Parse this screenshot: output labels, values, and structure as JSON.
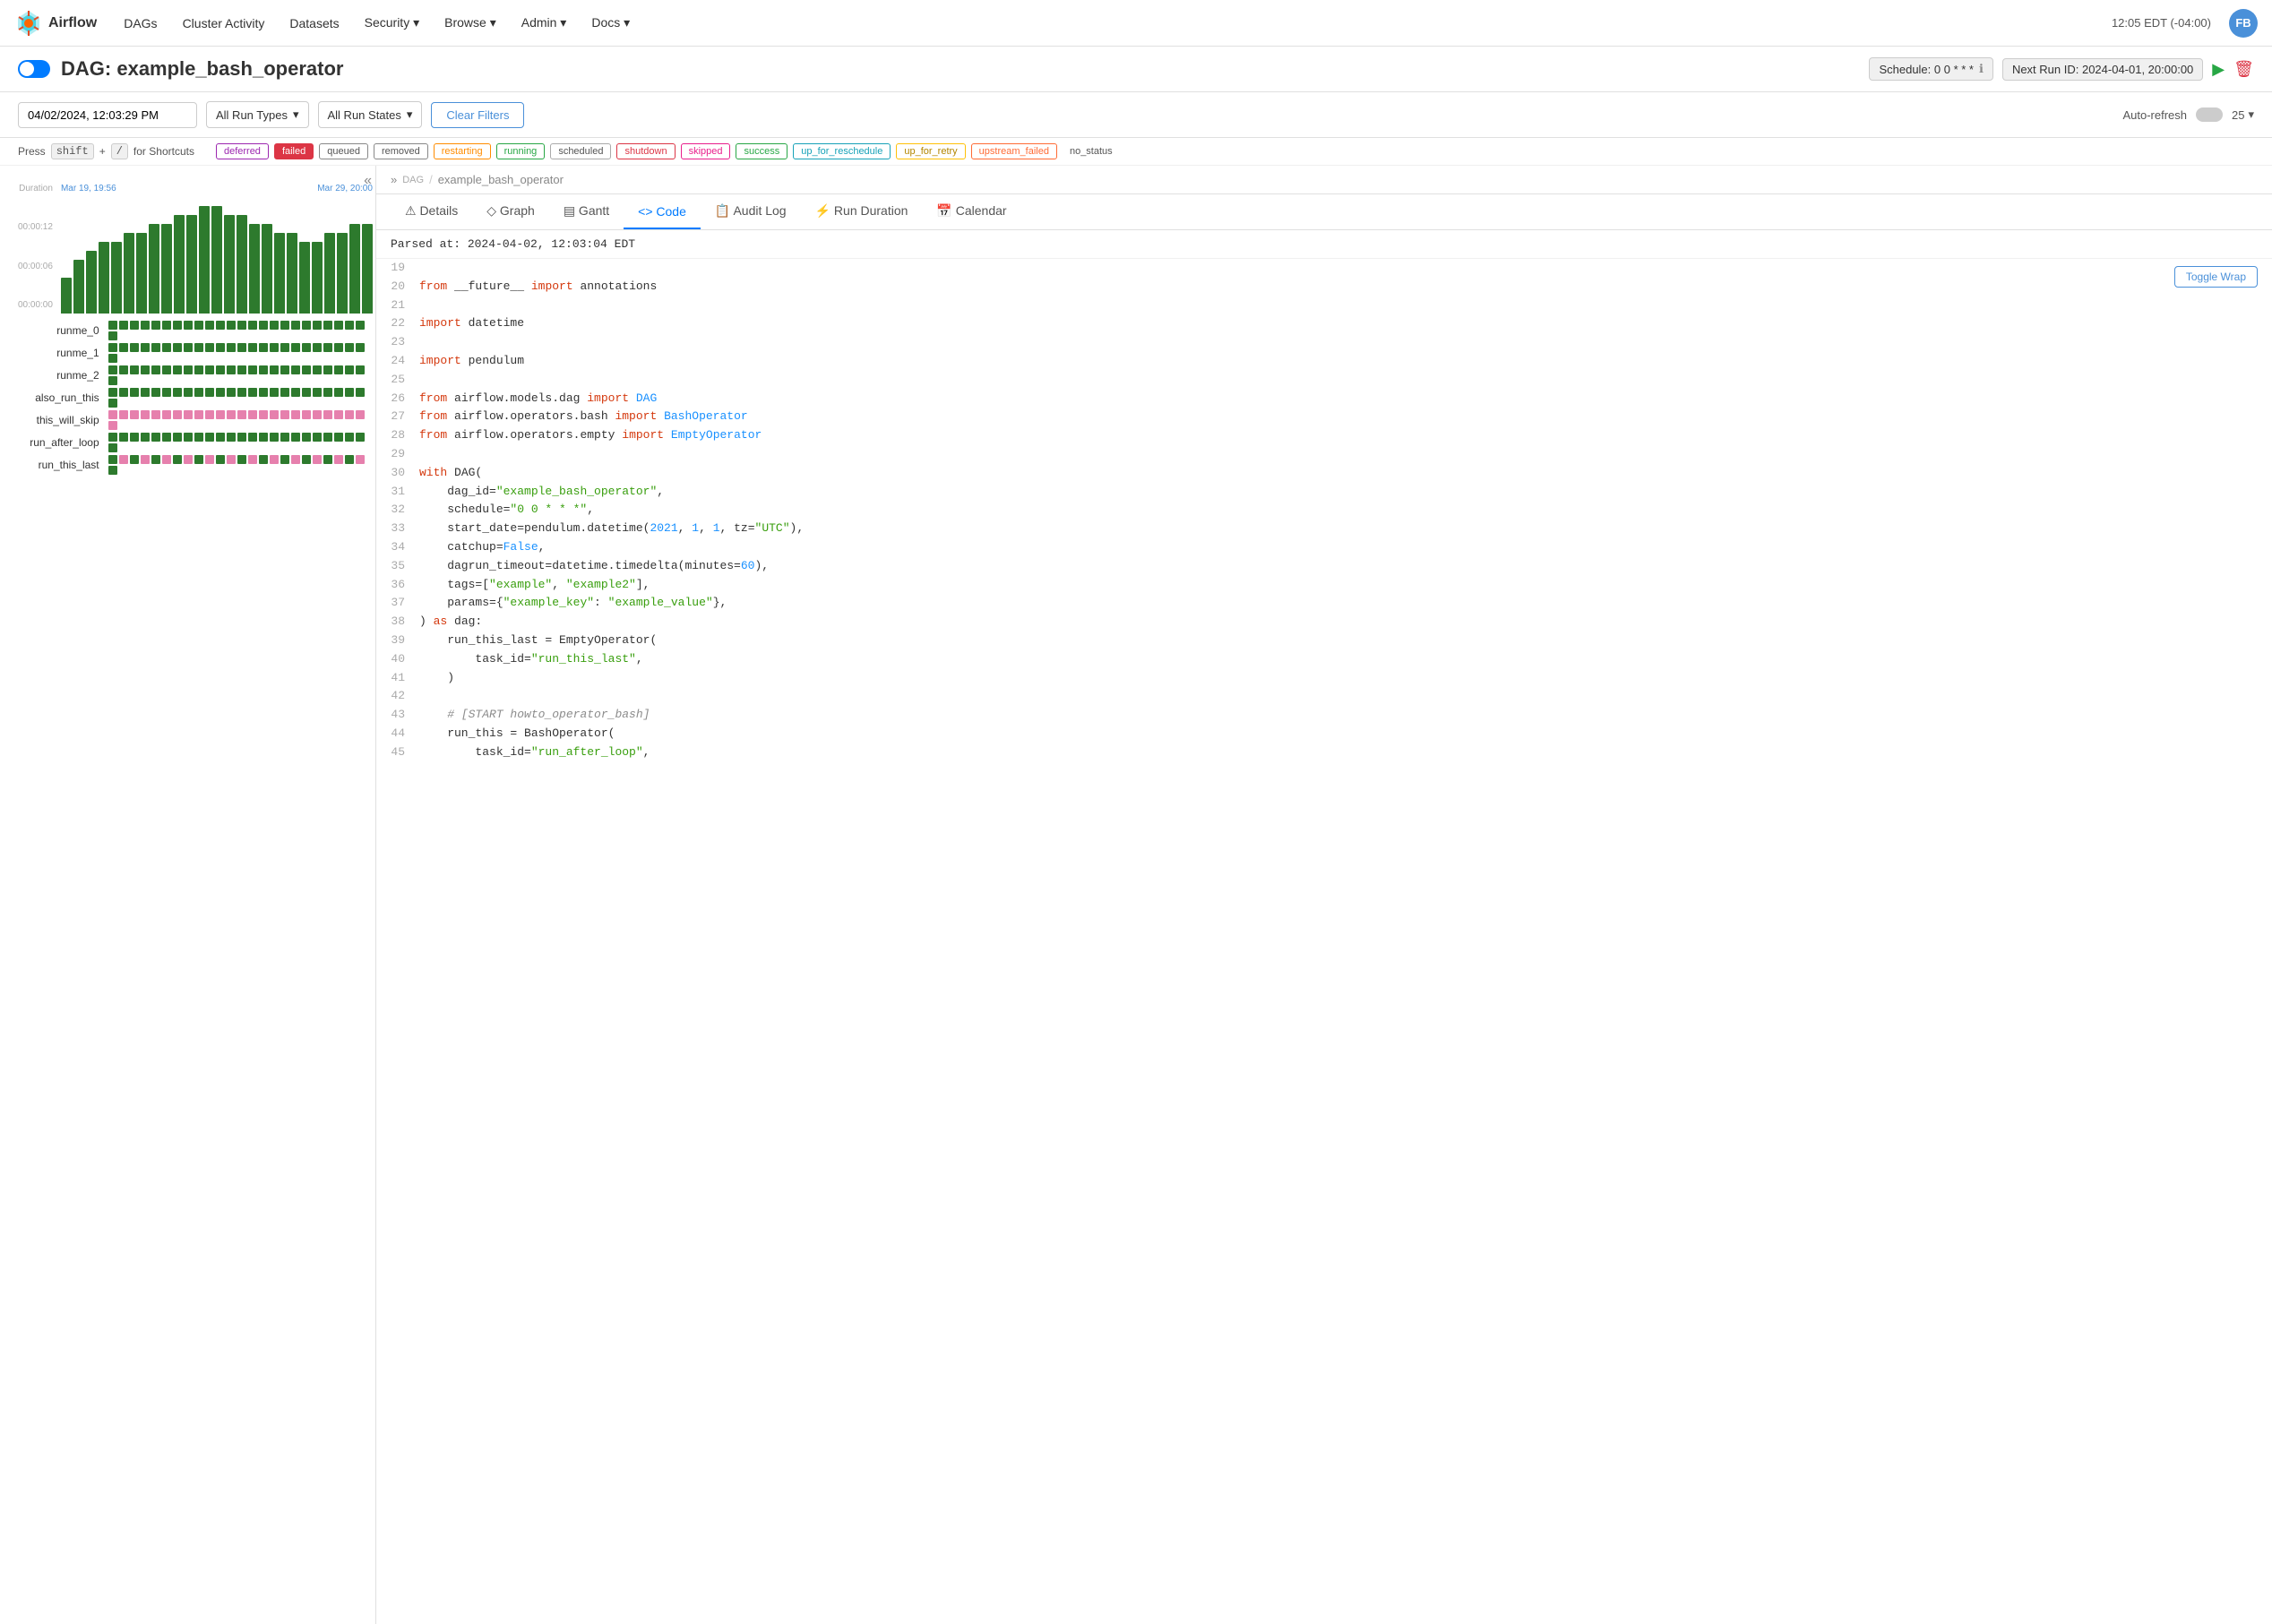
{
  "navbar": {
    "brand": "Airflow",
    "nav_items": [
      "DAGs",
      "Cluster Activity",
      "Datasets",
      "Security",
      "Browse",
      "Admin",
      "Docs"
    ],
    "time": "12:05 EDT (-04:00)",
    "avatar": "FB"
  },
  "dag_header": {
    "label": "DAG:",
    "name": "example_bash_operator",
    "schedule_label": "Schedule: 0 0 * * *",
    "next_run_label": "Next Run ID: 2024-04-01, 20:00:00",
    "toggle_label": "Toggle DAG"
  },
  "filters": {
    "date_value": "04/02/2024, 12:03:29 PM",
    "run_types_label": "All Run Types",
    "run_states_label": "All Run States",
    "clear_label": "Clear Filters",
    "auto_refresh_label": "Auto-refresh",
    "page_count": "25"
  },
  "shortcuts": {
    "hint": "Press",
    "key1": "shift",
    "plus": "+",
    "key2": "/",
    "hint2": "for Shortcuts"
  },
  "status_chips": [
    {
      "label": "deferred",
      "color": "#9c27b0",
      "bg": "transparent",
      "border": "#9c27b0"
    },
    {
      "label": "failed",
      "color": "#fff",
      "bg": "#dc3545",
      "border": "#dc3545"
    },
    {
      "label": "queued",
      "color": "#555",
      "bg": "transparent",
      "border": "#888"
    },
    {
      "label": "removed",
      "color": "#555",
      "bg": "transparent",
      "border": "#888"
    },
    {
      "label": "restarting",
      "color": "#ff8c00",
      "bg": "transparent",
      "border": "#ff8c00"
    },
    {
      "label": "running",
      "color": "#28a745",
      "bg": "transparent",
      "border": "#28a745"
    },
    {
      "label": "scheduled",
      "color": "#333",
      "bg": "transparent",
      "border": "#333"
    },
    {
      "label": "shutdown",
      "color": "#dc3545",
      "bg": "transparent",
      "border": "#dc3545"
    },
    {
      "label": "skipped",
      "color": "#e91e8c",
      "bg": "transparent",
      "border": "#e91e8c"
    },
    {
      "label": "success",
      "color": "#28a745",
      "bg": "transparent",
      "border": "#28a745"
    },
    {
      "label": "up_for_reschedule",
      "color": "#17a2b8",
      "bg": "transparent",
      "border": "#17a2b8"
    },
    {
      "label": "up_for_retry",
      "color": "#ffc107",
      "bg": "transparent",
      "border": "#ffc107"
    },
    {
      "label": "upstream_failed",
      "color": "#ff6b35",
      "bg": "transparent",
      "border": "#ff6b35"
    },
    {
      "label": "no_status",
      "color": "#333",
      "bg": "transparent",
      "border": "transparent"
    }
  ],
  "chart": {
    "duration_label": "Duration",
    "label_top": "00:00:12",
    "label_mid": "00:00:06",
    "label_bot": "00:00:00",
    "date_left": "Mar 19, 19:56",
    "date_right": "Mar 29, 20:00",
    "bars": [
      4,
      6,
      7,
      8,
      8,
      9,
      9,
      10,
      10,
      11,
      11,
      12,
      12,
      11,
      11,
      10,
      10,
      9,
      9,
      8,
      8,
      9,
      9,
      10,
      10
    ]
  },
  "tasks": [
    {
      "name": "runme_0",
      "dots": [
        1,
        1,
        1,
        1,
        1,
        1,
        1,
        1,
        1,
        1,
        1,
        1,
        1,
        1,
        1,
        1,
        1,
        1,
        1,
        1,
        1,
        1,
        1,
        1,
        1
      ],
      "type": "green"
    },
    {
      "name": "runme_1",
      "dots": [
        1,
        1,
        1,
        1,
        1,
        1,
        1,
        1,
        1,
        1,
        1,
        1,
        1,
        1,
        1,
        1,
        1,
        1,
        1,
        1,
        1,
        1,
        1,
        1,
        1
      ],
      "type": "green"
    },
    {
      "name": "runme_2",
      "dots": [
        1,
        1,
        1,
        1,
        1,
        1,
        1,
        1,
        1,
        1,
        1,
        1,
        1,
        1,
        1,
        1,
        1,
        1,
        1,
        1,
        1,
        1,
        1,
        1,
        1
      ],
      "type": "green"
    },
    {
      "name": "also_run_this",
      "dots": [
        1,
        1,
        1,
        1,
        1,
        1,
        1,
        1,
        1,
        1,
        1,
        1,
        1,
        1,
        1,
        1,
        1,
        1,
        1,
        1,
        1,
        1,
        1,
        1,
        1
      ],
      "type": "green"
    },
    {
      "name": "this_will_skip",
      "dots": [
        1,
        1,
        1,
        1,
        1,
        1,
        1,
        1,
        1,
        1,
        1,
        1,
        1,
        1,
        1,
        1,
        1,
        1,
        1,
        1,
        1,
        1,
        1,
        1,
        1
      ],
      "type": "pink"
    },
    {
      "name": "run_after_loop",
      "dots": [
        1,
        1,
        1,
        1,
        1,
        1,
        1,
        1,
        1,
        1,
        1,
        1,
        1,
        1,
        1,
        1,
        1,
        1,
        1,
        1,
        1,
        1,
        1,
        1,
        1
      ],
      "type": "green"
    },
    {
      "name": "run_this_last",
      "dots": [
        1,
        1,
        1,
        1,
        1,
        1,
        1,
        1,
        1,
        1,
        1,
        1,
        1,
        1,
        1,
        1,
        1,
        1,
        1,
        1,
        1,
        1,
        1,
        1,
        1
      ],
      "type": "mixed"
    }
  ],
  "dag_panel": {
    "breadcrumb": "DAG",
    "dag_name": "example_bash_operator"
  },
  "tabs": [
    {
      "label": "Details",
      "icon": "⚠"
    },
    {
      "label": "Graph",
      "icon": "◇"
    },
    {
      "label": "Gantt",
      "icon": "▤"
    },
    {
      "label": "Code",
      "icon": "<>",
      "active": true
    },
    {
      "label": "Audit Log",
      "icon": "📋"
    },
    {
      "label": "Run Duration",
      "icon": "⚡"
    },
    {
      "label": "Calendar",
      "icon": "📅"
    }
  ],
  "code": {
    "parsed_at": "Parsed at: 2024-04-02, 12:03:04 EDT",
    "toggle_wrap": "Toggle Wrap",
    "lines": [
      {
        "num": 19,
        "content": ""
      },
      {
        "num": 20,
        "html": "<span class='kw-from'>from</span> __future__ <span class='kw-import'>import</span> annotations"
      },
      {
        "num": 21,
        "content": ""
      },
      {
        "num": 22,
        "html": "<span class='kw-import'>import</span> datetime"
      },
      {
        "num": 23,
        "content": ""
      },
      {
        "num": 24,
        "html": "<span class='kw-import'>import</span> pendulum"
      },
      {
        "num": 25,
        "content": ""
      },
      {
        "num": 26,
        "html": "<span class='kw-from'>from</span> airflow.models.dag <span class='kw-import'>import</span> <span class='kw-blue'>DAG</span>"
      },
      {
        "num": 27,
        "html": "<span class='kw-from'>from</span> airflow.operators.bash <span class='kw-import'>import</span> <span class='kw-blue'>BashOperator</span>"
      },
      {
        "num": 28,
        "html": "<span class='kw-from'>from</span> airflow.operators.empty <span class='kw-import'>import</span> <span class='kw-blue'>EmptyOperator</span>"
      },
      {
        "num": 29,
        "content": ""
      },
      {
        "num": 30,
        "html": "<span class='kw-with'>with</span> DAG("
      },
      {
        "num": 31,
        "html": "    dag_id=<span class='str-green'>\"example_bash_operator\"</span>,"
      },
      {
        "num": 32,
        "html": "    schedule=<span class='str-green'>\"0 0 * * *\"</span>,"
      },
      {
        "num": 33,
        "html": "    start_date=pendulum.datetime(<span class='num'>2021</span>, <span class='num'>1</span>, <span class='num'>1</span>, tz=<span class='str-green'>\"UTC\"</span>),"
      },
      {
        "num": 34,
        "html": "    catchup=<span class='kw-false'>False</span>,"
      },
      {
        "num": 35,
        "html": "    dagrun_timeout=datetime.timedelta(minutes=<span class='num'>60</span>),"
      },
      {
        "num": 36,
        "html": "    tags=[<span class='str-green'>\"example\"</span>, <span class='str-green'>\"example2\"</span>],"
      },
      {
        "num": 37,
        "html": "    params={<span class='str-green'>\"example_key\"</span>: <span class='str-green'>\"example_value\"</span>},"
      },
      {
        "num": 38,
        "html": ") <span class='kw-as'>as</span> dag:"
      },
      {
        "num": 39,
        "html": "    run_this_last = EmptyOperator("
      },
      {
        "num": 40,
        "html": "        task_id=<span class='str-green'>\"run_this_last\"</span>,"
      },
      {
        "num": 41,
        "html": "    )"
      },
      {
        "num": 42,
        "content": ""
      },
      {
        "num": 43,
        "html": "    <span class='comment'># [START howto_operator_bash]</span>"
      },
      {
        "num": 44,
        "html": "    run_this = BashOperator("
      },
      {
        "num": 45,
        "html": "        task_id=<span class='str-green'>\"run_after_loop\"</span>,"
      }
    ]
  }
}
